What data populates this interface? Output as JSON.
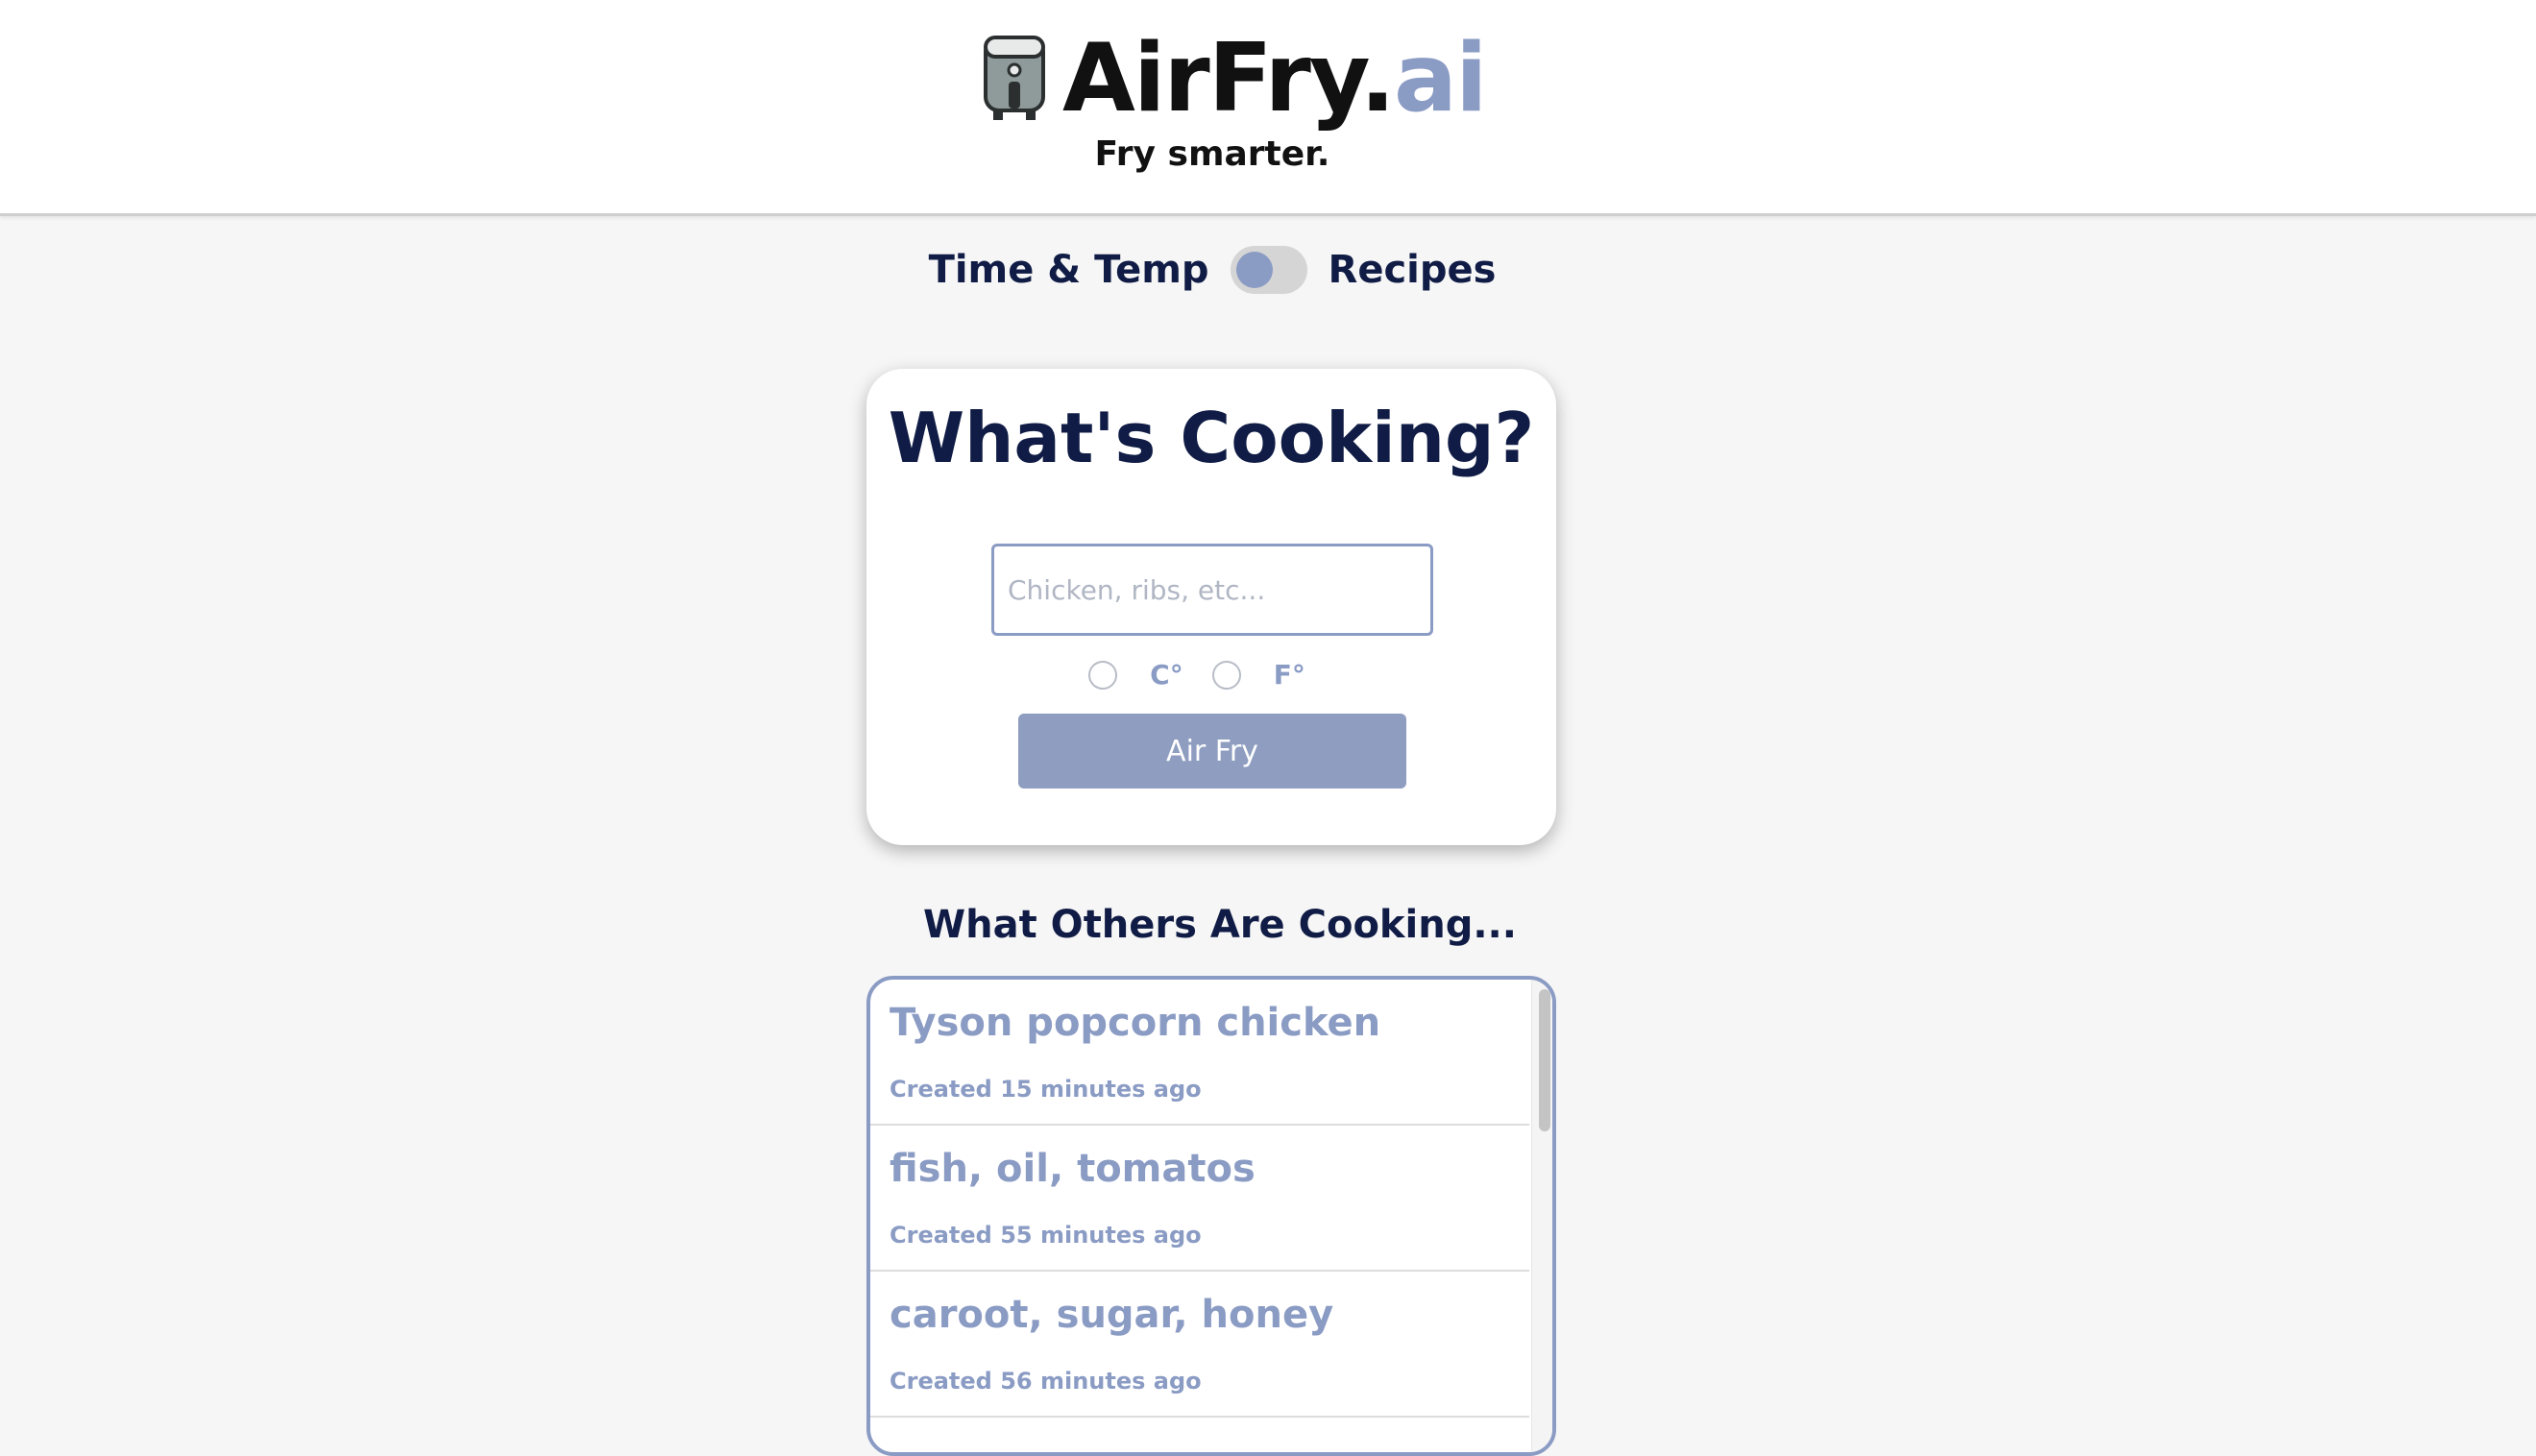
{
  "header": {
    "brand_main": "AirFry.",
    "brand_ai": "ai",
    "tagline": "Fry smarter."
  },
  "mode_toggle": {
    "left_label": "Time & Temp",
    "right_label": "Recipes"
  },
  "cook_card": {
    "title": "What's Cooking?",
    "input_placeholder": "Chicken, ribs, etc...",
    "input_value": "",
    "unit_c": "C°",
    "unit_f": "F°",
    "button_label": "Air Fry"
  },
  "others": {
    "title": "What Others Are Cooking...",
    "items": [
      {
        "title": "Tyson popcorn chicken",
        "meta": "Created 15 minutes ago"
      },
      {
        "title": "fish, oil, tomatos",
        "meta": "Created 55 minutes ago"
      },
      {
        "title": "caroot, sugar, honey",
        "meta": "Created 56 minutes ago"
      }
    ]
  },
  "colors": {
    "accent": "#8a9bc4",
    "navy_text": "#101c45",
    "button": "#8e9dc0",
    "background": "#f6f6f6"
  }
}
